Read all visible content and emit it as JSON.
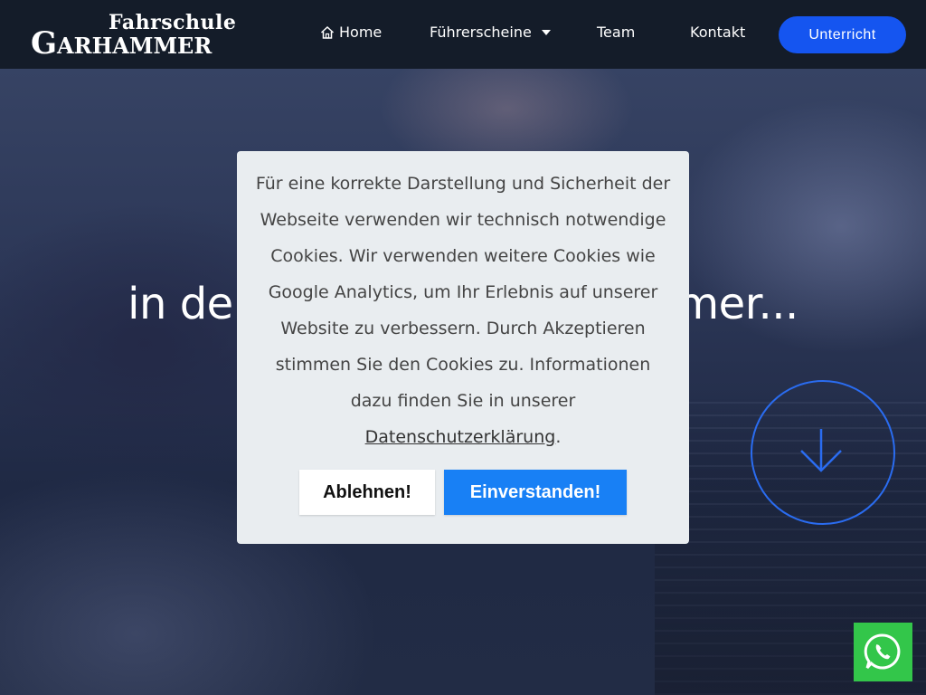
{
  "brand": {
    "logo_top": "Fahrschule",
    "logo_main": "Garhammer"
  },
  "nav": {
    "home_icon": "home-icon",
    "home": "Home",
    "licenses": "Führerscheine",
    "team": "Team",
    "contact": "Kontakt",
    "lessons_button": "Unterricht"
  },
  "hero": {
    "headline": "in der Fahrschule Garhammer...",
    "scroll_icon": "arrow-down-icon"
  },
  "cookie": {
    "text": "Für eine korrekte Darstellung und Sicherheit der Webseite verwenden wir technisch notwendige Cookies. Wir verwenden weitere Cookies wie Google Analytics, um Ihr Erlebnis auf unserer Website zu verbessern. Durch Akzeptieren stimmen Sie den Cookies zu. Informationen dazu finden Sie in unserer",
    "link": "Datenschutzerklärung",
    "period": ".",
    "decline": "Ablehnen!",
    "accept": "Einverstanden!"
  },
  "whatsapp": {
    "icon": "whatsapp-icon"
  },
  "colors": {
    "navbar": "#141c29",
    "primary_button": "#1555f0",
    "accept_button": "#1880f5",
    "modal_bg": "#e9edf0",
    "whatsapp": "#33c64a"
  }
}
